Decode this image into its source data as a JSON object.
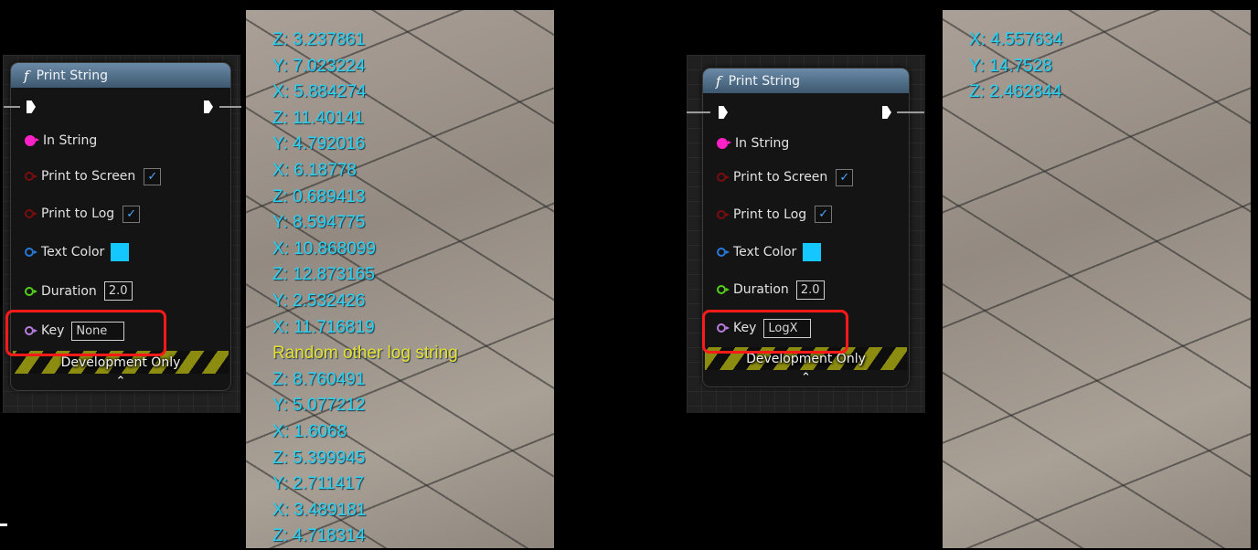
{
  "left_panel": {
    "node": {
      "title": "Print String",
      "function_glyph": "f",
      "pins": {
        "in_string": "In String",
        "print_to_screen": "Print to Screen",
        "print_to_log": "Print to Log",
        "text_color": "Text Color",
        "duration": "Duration",
        "key": "Key"
      },
      "values": {
        "print_to_screen_checked": "✓",
        "print_to_log_checked": "✓",
        "text_color": "#14c8ff",
        "duration": "2.0",
        "key": "None"
      },
      "dev_only_label": "Development Only",
      "collapse_glyph": "⌃"
    },
    "viewport_log": [
      "Z: 3.237861",
      "Y: 7.023224",
      "X: 5.884274",
      "Z: 11.40141",
      "Y: 4.792016",
      "X: 6.18778",
      "Z: 0.689413",
      "Y: 8.594775",
      "X: 10.868099",
      "Z: 12.873165",
      "Y: 2.532426",
      "X: 11.716819",
      "Random other log string",
      "Z: 8.760491",
      "Y: 5.077212",
      "X: 1.6068",
      "Z: 5.399945",
      "Y: 2.711417",
      "X: 3.489181",
      "Z: 4.718314"
    ]
  },
  "right_panel": {
    "node": {
      "title": "Print String",
      "function_glyph": "f",
      "pins": {
        "in_string": "In String",
        "print_to_screen": "Print to Screen",
        "print_to_log": "Print to Log",
        "text_color": "Text Color",
        "duration": "Duration",
        "key": "Key"
      },
      "values": {
        "print_to_screen_checked": "✓",
        "print_to_log_checked": "✓",
        "text_color": "#14c8ff",
        "duration": "2.0",
        "key": "LogX"
      },
      "dev_only_label": "Development Only",
      "collapse_glyph": "⌃"
    },
    "viewport_log": [
      "X: 4.557634",
      "Y: 14.7528",
      "Z: 2.462844"
    ]
  },
  "colors": {
    "log_text": "#2ad0f0",
    "log_other": "#e8e030",
    "highlight": "#ff1a1a",
    "string_pin": "#ff21c8"
  }
}
